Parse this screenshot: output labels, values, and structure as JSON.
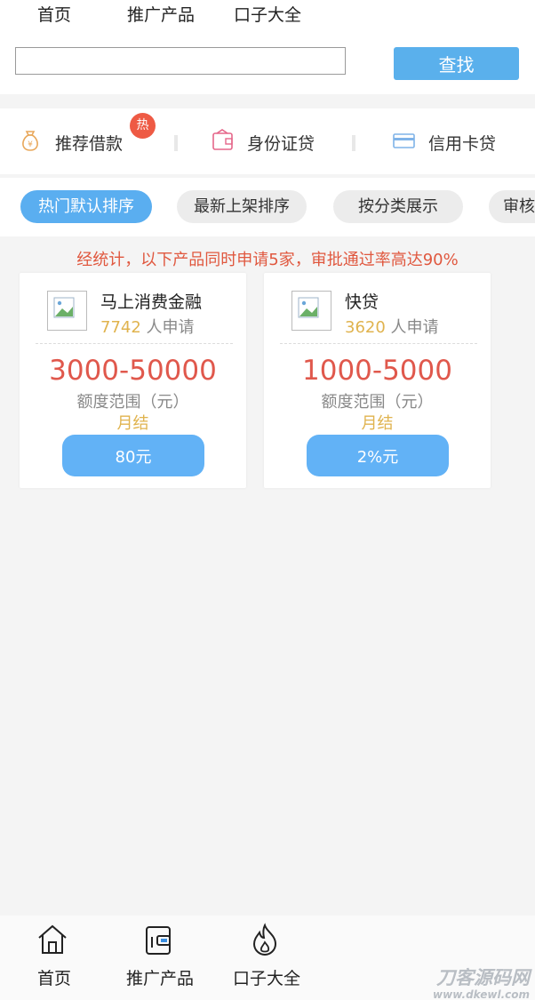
{
  "top_nav": {
    "tabs": [
      {
        "label": "首页"
      },
      {
        "label": "推广产品"
      },
      {
        "label": "口子大全"
      }
    ]
  },
  "search": {
    "placeholder": "",
    "value": "",
    "button_label": "查找"
  },
  "categories": [
    {
      "label": "推荐借款",
      "icon": "money-bag-icon",
      "badge": "热"
    },
    {
      "label": "身份证贷",
      "icon": "wallet-card-icon"
    },
    {
      "label": "信用卡贷",
      "icon": "credit-card-icon"
    }
  ],
  "sort_options": [
    {
      "label": "热门默认排序",
      "active": true
    },
    {
      "label": "最新上架排序",
      "active": false
    },
    {
      "label": "按分类展示",
      "active": false
    },
    {
      "label": "审核",
      "active": false
    }
  ],
  "stat_note": "经统计，以下产品同时申请5家，审批通过率高达90%",
  "products": [
    {
      "name": "马上消费金融",
      "applicant_count": "7742",
      "applicant_suffix": " 人申请",
      "amount_range": "3000-50000",
      "range_label": "额度范围（元）",
      "term": "月结",
      "button_label": "80元"
    },
    {
      "name": "快贷",
      "applicant_count": "3620",
      "applicant_suffix": " 人申请",
      "amount_range": "1000-5000",
      "range_label": "额度范围（元）",
      "term": "月结",
      "button_label": "2%元"
    }
  ],
  "bottom_nav": {
    "items": [
      {
        "label": "首页",
        "icon": "home-icon"
      },
      {
        "label": "推广产品",
        "icon": "wallet-icon"
      },
      {
        "label": "口子大全",
        "icon": "fire-icon"
      }
    ]
  },
  "watermark": {
    "line1": "刀客源码网",
    "line2": "www.dkewl.com"
  },
  "colors": {
    "accent_blue": "#5ab0ec",
    "highlight_red": "#e0584c",
    "gold": "#e0b34e",
    "badge_red": "#ee5a44"
  }
}
